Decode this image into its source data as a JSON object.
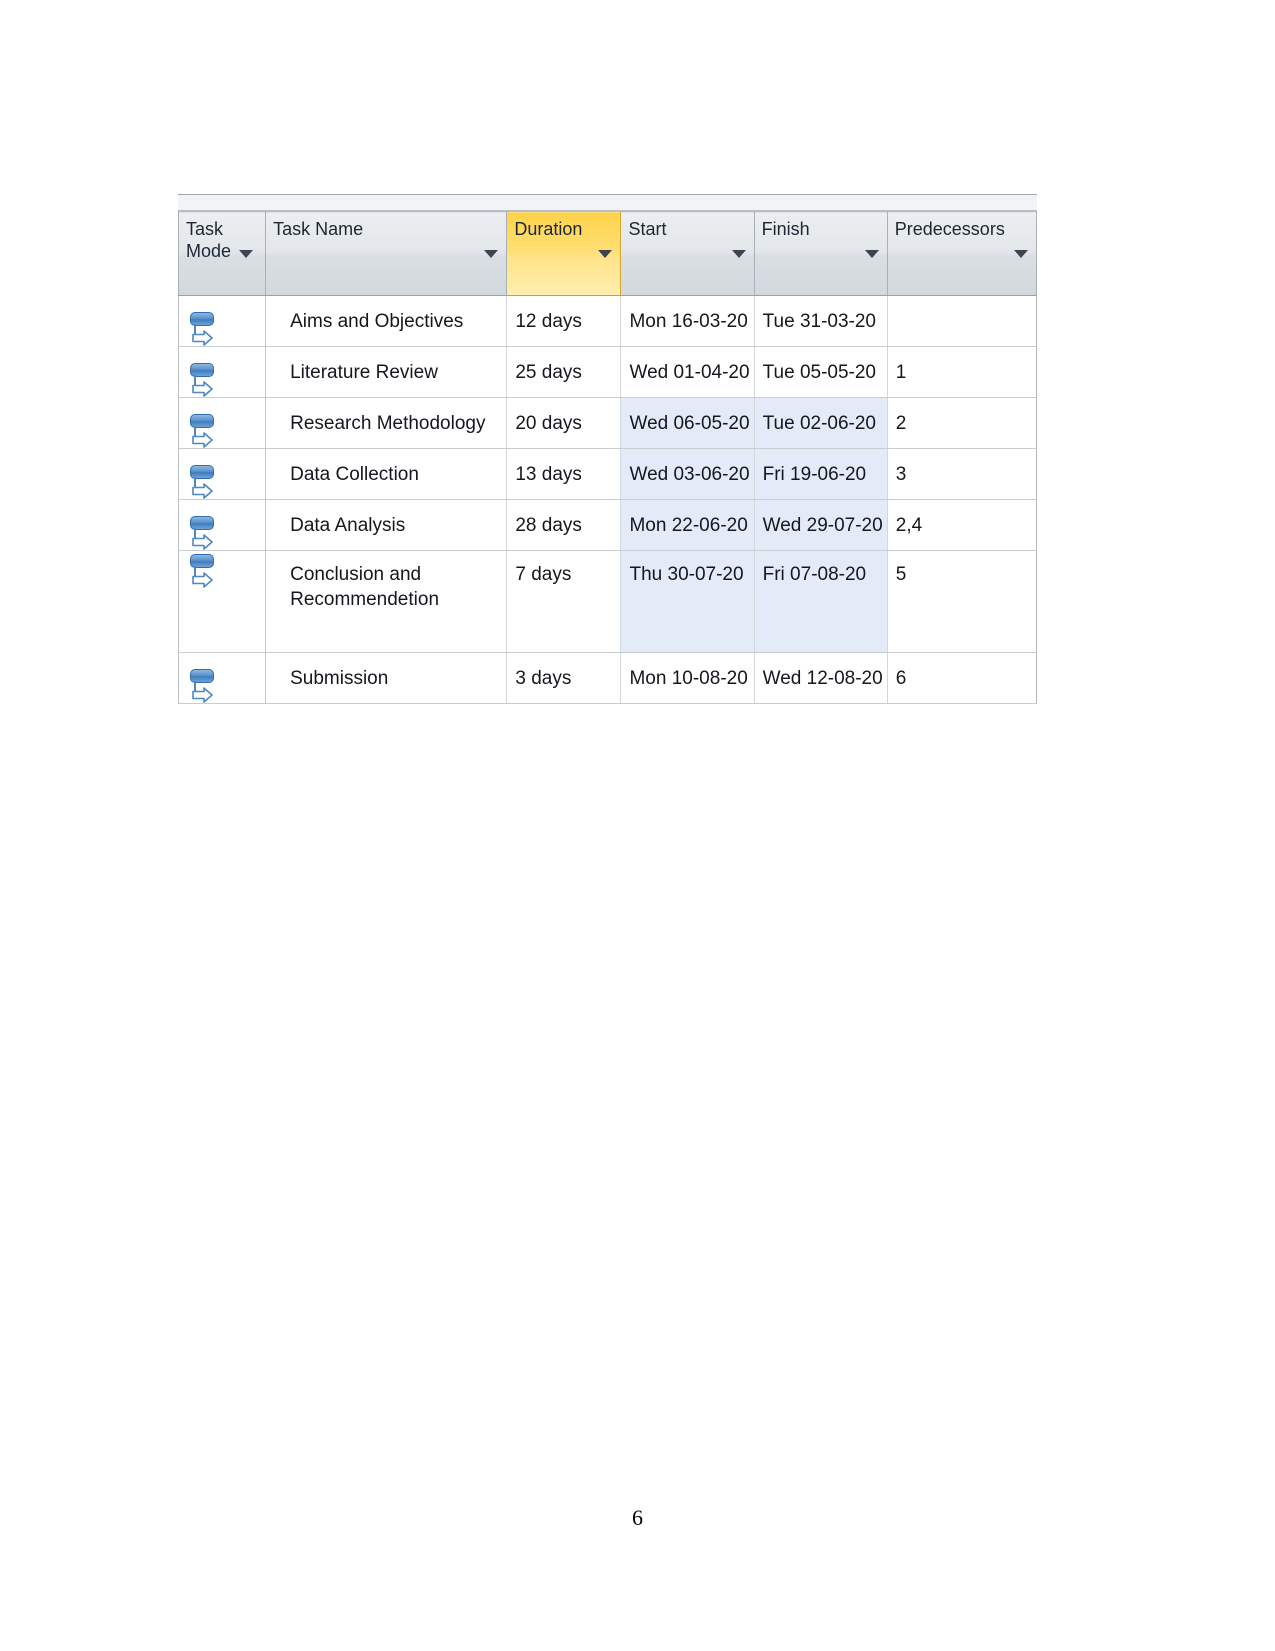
{
  "page": {
    "number": "6"
  },
  "screenshot": {
    "name": "ms-project-gantt-entry-table",
    "colors": {
      "header_background": "#e2e6ea",
      "selected_column_header": "#ffdf73",
      "selection_highlight": "#e2ebf7",
      "grid_line": "#c9ccd0",
      "task_mode_icon": "#3f7cbd",
      "text": "#14181d"
    }
  },
  "table": {
    "columns": [
      {
        "key": "task_mode",
        "label": "Task Mode",
        "has_filter": true,
        "selected": false
      },
      {
        "key": "task_name",
        "label": "Task Name",
        "has_filter": true,
        "selected": false
      },
      {
        "key": "duration",
        "label": "Duration",
        "has_filter": true,
        "selected": true
      },
      {
        "key": "start",
        "label": "Start",
        "has_filter": true,
        "selected": false
      },
      {
        "key": "finish",
        "label": "Finish",
        "has_filter": true,
        "selected": false
      },
      {
        "key": "predecessors",
        "label": "Predecessors",
        "has_filter": true,
        "selected": false
      }
    ],
    "rows": [
      {
        "task_mode": "auto-scheduled",
        "task_name": "Aims and Objectives",
        "duration": "12 days",
        "start": "Mon 16-03-20",
        "finish": "Tue 31-03-20",
        "predecessors": "",
        "selected": false,
        "tall": false
      },
      {
        "task_mode": "auto-scheduled",
        "task_name": "Literature Review",
        "duration": "25 days",
        "start": "Wed 01-04-20",
        "finish": "Tue 05-05-20",
        "predecessors": "1",
        "selected": false,
        "tall": false
      },
      {
        "task_mode": "auto-scheduled",
        "task_name": "Research Methodology",
        "duration": "20 days",
        "start": "Wed 06-05-20",
        "finish": "Tue 02-06-20",
        "predecessors": "2",
        "selected": true,
        "tall": false
      },
      {
        "task_mode": "auto-scheduled",
        "task_name": "Data Collection",
        "duration": "13 days",
        "start": "Wed 03-06-20",
        "finish": "Fri 19-06-20",
        "predecessors": "3",
        "selected": true,
        "tall": false
      },
      {
        "task_mode": "auto-scheduled",
        "task_name": "Data Analysis",
        "duration": "28 days",
        "start": "Mon 22-06-20",
        "finish": "Wed 29-07-20",
        "predecessors": "2,4",
        "selected": true,
        "tall": false
      },
      {
        "task_mode": "auto-scheduled",
        "task_name": "Conclusion and Recommendetion",
        "duration": "7 days",
        "start": "Thu 30-07-20",
        "finish": "Fri 07-08-20",
        "predecessors": "5",
        "selected": true,
        "tall": true
      },
      {
        "task_mode": "auto-scheduled",
        "task_name": "Submission",
        "duration": "3 days",
        "start": "Mon 10-08-20",
        "finish": "Wed 12-08-20",
        "predecessors": "6",
        "selected": false,
        "tall": false
      }
    ]
  }
}
